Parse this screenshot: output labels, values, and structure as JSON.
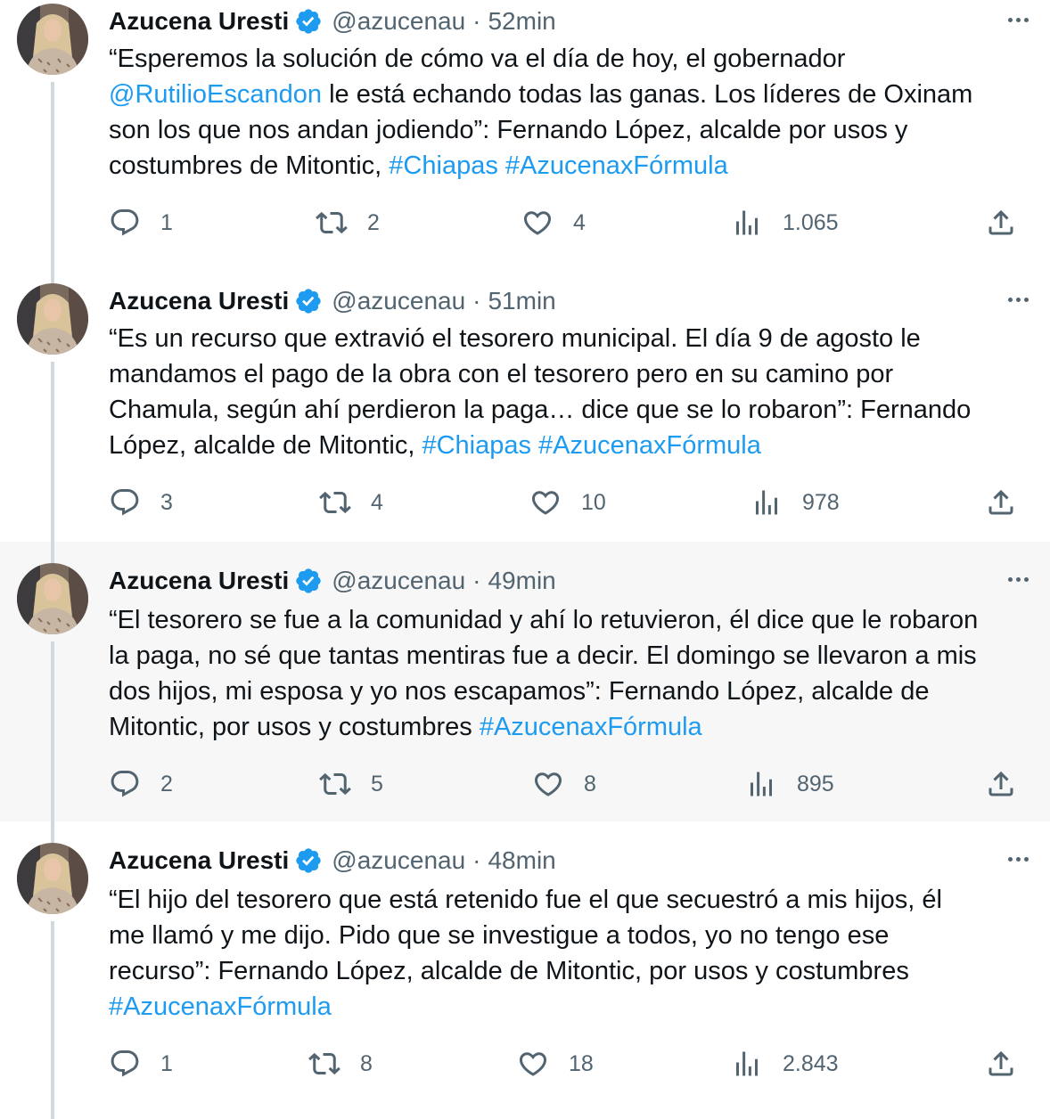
{
  "accent_color": "#1d9bf0",
  "icons": {
    "verified": "verified-badge-icon",
    "more": "more-icon",
    "reply": "reply-icon",
    "retweet": "retweet-icon",
    "like": "like-icon",
    "views": "views-icon",
    "share": "share-icon"
  },
  "tweets": [
    {
      "name": "Azucena Uresti",
      "handle": "@azucenau",
      "sep": "·",
      "time": "52min",
      "text": {
        "l1": "“Esperemos la solución de cómo va el día de hoy, el gobernador",
        "mention": "@RutilioEscandon",
        "l2b": " le está echando todas las ganas. Los líderes de Oxinam",
        "l3": "son los que nos andan jodiendo”: Fernando López, alcalde por usos y",
        "l4a": "costumbres de Mitontic, ",
        "tag1": "#Chiapas",
        "tag2": " #AzucenaxFórmula"
      },
      "replies": "1",
      "retweets": "2",
      "likes": "4",
      "views": "1.065"
    },
    {
      "name": "Azucena Uresti",
      "handle": "@azucenau",
      "sep": "·",
      "time": "51min",
      "text": {
        "l1": "“Es un recurso que extravió el tesorero municipal. El día 9 de agosto le",
        "l2": "mandamos el pago de la obra con el tesorero pero en su camino por",
        "l3": "Chamula, según ahí perdieron la paga… dice que se lo robaron”: Fernando",
        "l4a": "López, alcalde de Mitontic, ",
        "tag1": "#Chiapas",
        "tag2": " #AzucenaxFórmula"
      },
      "replies": "3",
      "retweets": "4",
      "likes": "10",
      "views": "978"
    },
    {
      "name": "Azucena Uresti",
      "handle": "@azucenau",
      "sep": "·",
      "time": "49min",
      "text": {
        "l1": "“El tesorero se fue a la comunidad y ahí lo retuvieron, él dice que le robaron",
        "l2": "la paga, no sé que tantas mentiras fue a decir. El domingo se llevaron a mis",
        "l3": "dos hijos, mi esposa y yo nos escapamos”: Fernando López, alcalde de",
        "l4a": "Mitontic, por usos y costumbres ",
        "tag1": "#AzucenaxFórmula"
      },
      "replies": "2",
      "retweets": "5",
      "likes": "8",
      "views": "895"
    },
    {
      "name": "Azucena Uresti",
      "handle": "@azucenau",
      "sep": "·",
      "time": "48min",
      "text": {
        "l1": "“El hijo del tesorero que está retenido fue el que secuestró a mis hijos, él",
        "l2": "me llamó y me dijo. Pido que se investigue a todos, yo no tengo ese",
        "l3": "recurso”: Fernando López, alcalde de Mitontic, por usos y costumbres",
        "tag1": "#AzucenaxFórmula"
      },
      "replies": "1",
      "retweets": "8",
      "likes": "18",
      "views": "2.843"
    }
  ]
}
